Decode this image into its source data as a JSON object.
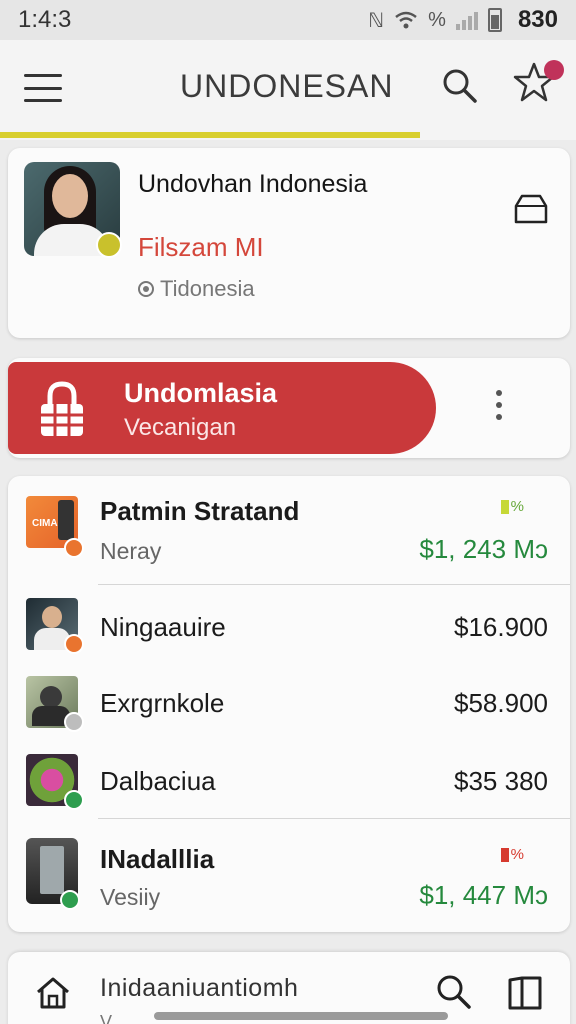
{
  "status_bar": {
    "time": "1:4:3",
    "right_text": "830",
    "icons": [
      "nfc-icon",
      "wifi-icon",
      "percent-icon",
      "signal-icon",
      "battery-icon"
    ]
  },
  "app_bar": {
    "title": "UNDONESAN",
    "accent_color": "#d8cf2e",
    "icons": [
      "menu-icon",
      "search-icon",
      "star-icon"
    ]
  },
  "profile": {
    "name": "Undovhan Indonesia",
    "role": "Filszam MI",
    "location": "Tidonesia",
    "role_color": "#d4473b"
  },
  "banner": {
    "title": "Undomlasia",
    "subtitle": "Vecanigan",
    "color": "#c9393b"
  },
  "list": {
    "items": [
      {
        "label": "Patmin Stratand",
        "sub": "Neray",
        "price": "$1, 243 Mɔ",
        "pct": "%",
        "pct_color": "#c6d836",
        "bold": true,
        "green": true
      },
      {
        "label": "Ningaauire",
        "sub": "",
        "price": "$16.900",
        "pct": "",
        "bold": false,
        "green": false
      },
      {
        "label": "Exrgrnkole",
        "sub": "",
        "price": "$58.900",
        "pct": "",
        "bold": false,
        "green": false
      },
      {
        "label": "Dalbaciua",
        "sub": "",
        "price": "$35 380",
        "pct": "",
        "bold": false,
        "green": false
      },
      {
        "label": "INadalllia",
        "sub": "Vesiiy",
        "price": "$1, 447 Mɔ",
        "pct": "%",
        "pct_color": "#d63a2f",
        "bold": true,
        "green": true
      }
    ]
  },
  "bottom_nav": {
    "label": "Inidaaniuantiomh",
    "sublabel": "V",
    "icons": [
      "home-icon",
      "search-icon",
      "book-icon"
    ]
  }
}
